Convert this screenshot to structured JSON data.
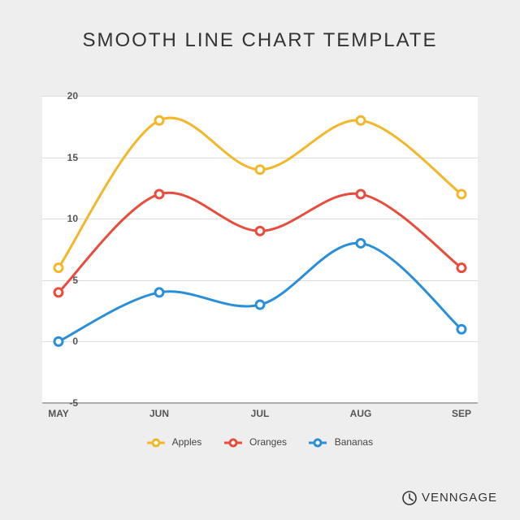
{
  "title": "SMOOTH LINE CHART TEMPLATE",
  "brand": "VENNGAGE",
  "legend": {
    "apples": "Apples",
    "oranges": "Oranges",
    "bananas": "Bananas"
  },
  "yticks": [
    "-5",
    "0",
    "5",
    "10",
    "15",
    "20"
  ],
  "xticks": [
    "MAY",
    "JUN",
    "JUL",
    "AUG",
    "SEP"
  ],
  "colors": {
    "apples": "#f2b72a",
    "oranges": "#e84c3d",
    "bananas": "#2a8fd8"
  },
  "chart_data": {
    "type": "line",
    "categories": [
      "MAY",
      "JUN",
      "JUL",
      "AUG",
      "SEP"
    ],
    "series": [
      {
        "name": "Apples",
        "values": [
          6,
          18,
          14,
          18,
          12
        ]
      },
      {
        "name": "Oranges",
        "values": [
          4,
          12,
          9,
          12,
          6
        ]
      },
      {
        "name": "Bananas",
        "values": [
          0,
          4,
          3,
          8,
          1
        ]
      }
    ],
    "title": "SMOOTH LINE CHART TEMPLATE",
    "xlabel": "",
    "ylabel": "",
    "ylim": [
      -5,
      20
    ]
  }
}
